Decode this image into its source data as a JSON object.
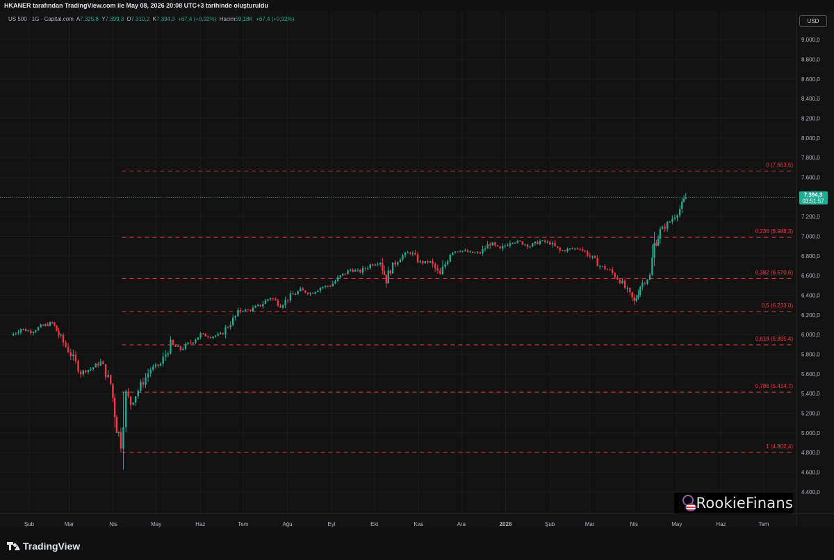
{
  "header": {
    "title": "HKANER tarafından TradingView.com ile May 08, 2026 20:08 UTC+3 tarihinde oluşturuldu"
  },
  "legend": {
    "symbol": "US 500 · 1G · Capital.com",
    "open_label": "A",
    "open": "7.325,8",
    "high_label": "Y",
    "high": "7.399,3",
    "low_label": "D",
    "low": "7.310,2",
    "close_label": "K",
    "close": "7.394,3",
    "change": "+67,4 (+0,92%)",
    "volume_label": "Hacim",
    "volume": "59,18K",
    "volume_change": "+67,4 (+0,92%)"
  },
  "currency_button": "USD",
  "footer": {
    "brand": "TradingView"
  },
  "watermark": {
    "text": "RookieFinans"
  },
  "last_price": {
    "value": "7.394,3",
    "timer": "03:51:57",
    "price": 7394.3
  },
  "colors": {
    "up": "#22ab94",
    "down": "#f23645",
    "fib": "#f23645",
    "background": "#121212",
    "axis_text": "#b2b5be"
  },
  "chart_data": {
    "type": "candlestick",
    "title": "",
    "ylim": [
      4300,
      9100
    ],
    "y_ticks": [
      "9.000,0",
      "8.800,0",
      "8.600,0",
      "8.400,0",
      "8.200,0",
      "8.000,0",
      "7.800,0",
      "7.600,0",
      "7.400,0",
      "7.200,0",
      "7.000,0",
      "6.800,0",
      "6.600,0",
      "6.400,0",
      "6.200,0",
      "6.000,0",
      "5.800,0",
      "5.600,0",
      "5.400,0",
      "5.200,0",
      "5.000,0",
      "4.800,0",
      "4.600,0",
      "4.400,0"
    ],
    "y_tick_values": [
      9000,
      8800,
      8600,
      8400,
      8200,
      8000,
      7800,
      7600,
      7400,
      7200,
      7000,
      6800,
      6600,
      6400,
      6200,
      6000,
      5800,
      5600,
      5400,
      5200,
      5000,
      4800,
      4600,
      4400
    ],
    "x_labels": [
      "Şub",
      "Mar",
      "Nis",
      "May",
      "Haz",
      "Tem",
      "Ağu",
      "Eyl",
      "Eki",
      "Kas",
      "Ara",
      "2026",
      "Şub",
      "Mar",
      "Nis",
      "May",
      "Haz",
      "Tem"
    ],
    "x_label_dates": [
      "2025-02-01",
      "2025-03-01",
      "2025-04-01",
      "2025-05-01",
      "2025-06-01",
      "2025-07-01",
      "2025-08-01",
      "2025-09-01",
      "2025-10-01",
      "2025-11-01",
      "2025-12-01",
      "2026-01-01",
      "2026-02-01",
      "2026-03-01",
      "2026-04-01",
      "2026-05-01",
      "2026-06-01",
      "2026-07-01"
    ],
    "x_bold_labels": [
      "2026"
    ],
    "fibonacci": {
      "start_date": "2025-04-07",
      "levels": [
        {
          "label": "0 (7.663,6)",
          "value": 7663.6
        },
        {
          "label": "0,236 (6.988,3)",
          "value": 6988.3
        },
        {
          "label": "0,382 (6.570,6)",
          "value": 6570.6
        },
        {
          "label": "0,5 (6.233,0)",
          "value": 6233.0
        },
        {
          "label": "0,618 (5.895,4)",
          "value": 5895.4
        },
        {
          "label": "0,786 (5.414,7)",
          "value": 5414.7
        },
        {
          "label": "1 (4.802,4)",
          "value": 4802.4
        }
      ]
    },
    "price_path": [
      [
        "2025-01-20",
        5990
      ],
      [
        "2025-01-27",
        6060
      ],
      [
        "2025-02-03",
        6030
      ],
      [
        "2025-02-10",
        6080
      ],
      [
        "2025-02-18",
        6120
      ],
      [
        "2025-02-24",
        5960
      ],
      [
        "2025-03-03",
        5800
      ],
      [
        "2025-03-10",
        5620
      ],
      [
        "2025-03-17",
        5650
      ],
      [
        "2025-03-24",
        5720
      ],
      [
        "2025-03-31",
        5500
      ],
      [
        "2025-04-04",
        5080
      ],
      [
        "2025-04-07",
        4900
      ],
      [
        "2025-04-09",
        5450
      ],
      [
        "2025-04-14",
        5300
      ],
      [
        "2025-04-21",
        5480
      ],
      [
        "2025-04-28",
        5650
      ],
      [
        "2025-05-05",
        5700
      ],
      [
        "2025-05-12",
        5900
      ],
      [
        "2025-05-19",
        5850
      ],
      [
        "2025-05-26",
        5920
      ],
      [
        "2025-06-02",
        6000
      ],
      [
        "2025-06-09",
        5980
      ],
      [
        "2025-06-16",
        6000
      ],
      [
        "2025-06-23",
        6120
      ],
      [
        "2025-06-30",
        6250
      ],
      [
        "2025-07-07",
        6250
      ],
      [
        "2025-07-14",
        6300
      ],
      [
        "2025-07-21",
        6380
      ],
      [
        "2025-07-28",
        6300
      ],
      [
        "2025-08-04",
        6390
      ],
      [
        "2025-08-11",
        6450
      ],
      [
        "2025-08-18",
        6420
      ],
      [
        "2025-08-25",
        6480
      ],
      [
        "2025-09-01",
        6500
      ],
      [
        "2025-09-08",
        6590
      ],
      [
        "2025-09-15",
        6660
      ],
      [
        "2025-09-22",
        6640
      ],
      [
        "2025-09-29",
        6710
      ],
      [
        "2025-10-06",
        6740
      ],
      [
        "2025-10-10",
        6560
      ],
      [
        "2025-10-13",
        6670
      ],
      [
        "2025-10-20",
        6790
      ],
      [
        "2025-10-27",
        6840
      ],
      [
        "2025-11-03",
        6730
      ],
      [
        "2025-11-10",
        6740
      ],
      [
        "2025-11-17",
        6600
      ],
      [
        "2025-11-24",
        6840
      ],
      [
        "2025-12-01",
        6860
      ],
      [
        "2025-12-08",
        6830
      ],
      [
        "2025-12-15",
        6830
      ],
      [
        "2025-12-22",
        6930
      ],
      [
        "2025-12-29",
        6860
      ],
      [
        "2026-01-05",
        6950
      ],
      [
        "2026-01-12",
        6940
      ],
      [
        "2026-01-19",
        6900
      ],
      [
        "2026-01-26",
        6950
      ],
      [
        "2026-02-02",
        6930
      ],
      [
        "2026-02-09",
        6850
      ],
      [
        "2026-02-16",
        6870
      ],
      [
        "2026-02-23",
        6880
      ],
      [
        "2026-03-02",
        6800
      ],
      [
        "2026-03-09",
        6700
      ],
      [
        "2026-03-16",
        6650
      ],
      [
        "2026-03-23",
        6550
      ],
      [
        "2026-03-30",
        6400
      ],
      [
        "2026-04-02",
        6330
      ],
      [
        "2026-04-06",
        6500
      ],
      [
        "2026-04-13",
        6600
      ],
      [
        "2026-04-16",
        6900
      ],
      [
        "2026-04-20",
        7050
      ],
      [
        "2026-04-27",
        7150
      ],
      [
        "2026-05-04",
        7280
      ],
      [
        "2026-05-08",
        7394.3
      ]
    ]
  }
}
